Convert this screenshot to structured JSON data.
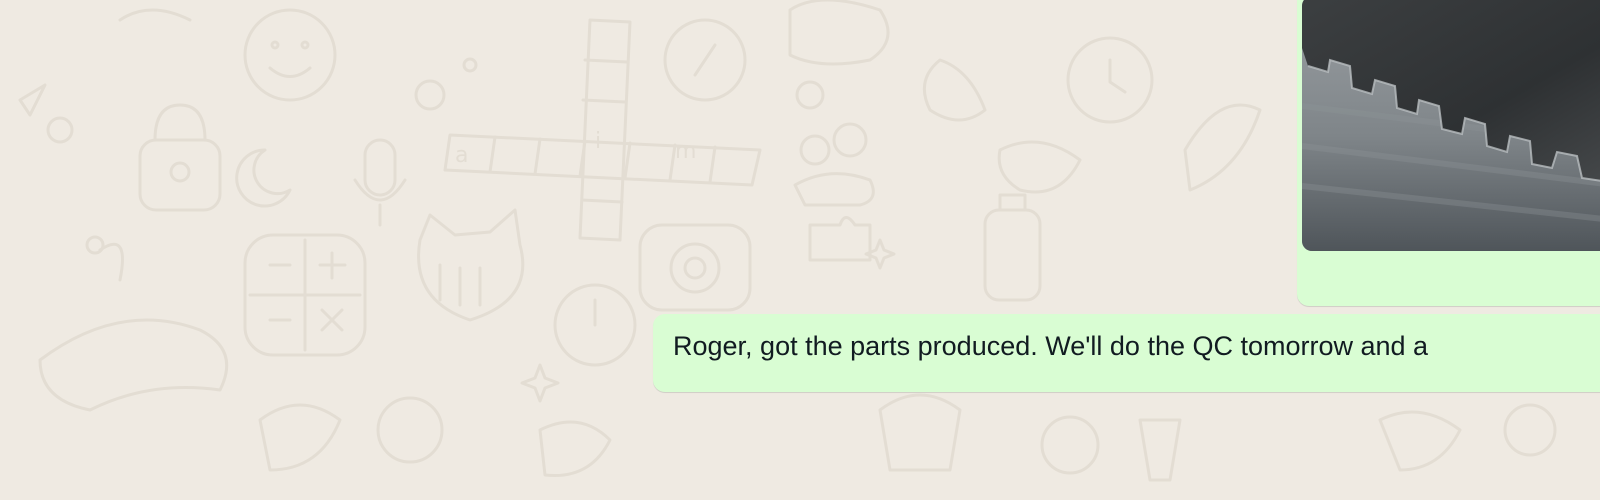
{
  "conversation": {
    "messages": [
      {
        "type": "image",
        "direction": "outgoing",
        "image_alt": "photo-of-toothed-metal-part"
      },
      {
        "type": "text",
        "direction": "outgoing",
        "text": "Roger, got the parts produced. We'll do the QC tomorrow and a"
      }
    ]
  },
  "colors": {
    "chat_background": "#efeae2",
    "outgoing_bubble": "#d9fdd3",
    "message_text": "#111b21"
  }
}
